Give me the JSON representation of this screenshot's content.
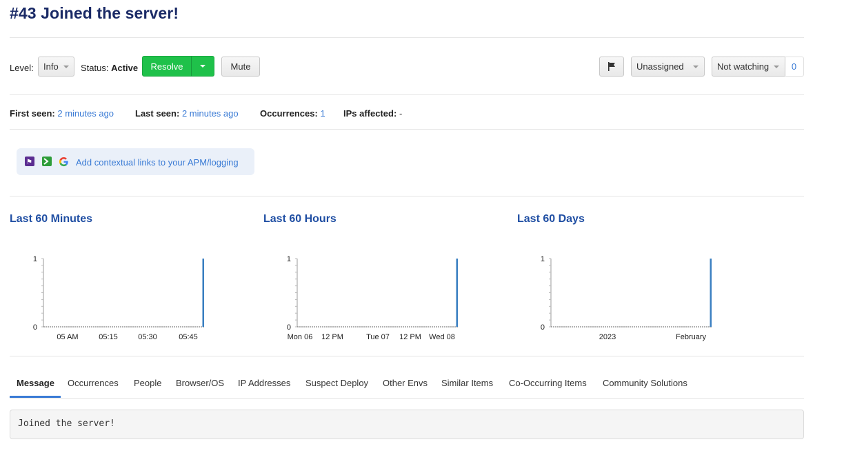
{
  "title": "#43 Joined the server!",
  "controls": {
    "level_label": "Level:",
    "level_value": "Info",
    "status_label": "Status:",
    "status_value": "Active",
    "resolve_label": "Resolve",
    "mute_label": "Mute",
    "assignee_value": "Unassigned",
    "watch_value": "Not watching",
    "watch_count": "0"
  },
  "meta": {
    "first_seen_label": "First seen:",
    "first_seen_value": "2 minutes ago",
    "last_seen_label": "Last seen:",
    "last_seen_value": "2 minutes ago",
    "occurrences_label": "Occurrences:",
    "occurrences_value": "1",
    "ips_label": "IPs affected:",
    "ips_value": "-"
  },
  "contextual_link": "Add contextual links to your APM/logging",
  "charts": {
    "minutes_title": "Last 60 Minutes",
    "hours_title": "Last 60 Hours",
    "days_title": "Last 60 Days"
  },
  "chart_data": [
    {
      "type": "bar",
      "title": "Last 60 Minutes",
      "ylim": [
        0,
        1
      ],
      "yticks": [
        "0",
        "1"
      ],
      "xticks": [
        "05 AM",
        "05:15",
        "05:30",
        "05:45"
      ],
      "values_note_last_bucket": 1,
      "series": [
        {
          "values": [
            0,
            0,
            0,
            0,
            0,
            0,
            0,
            0,
            0,
            0,
            0,
            0,
            0,
            0,
            0,
            0,
            0,
            0,
            0,
            0,
            0,
            0,
            0,
            0,
            0,
            0,
            0,
            0,
            0,
            0,
            0,
            0,
            0,
            0,
            0,
            0,
            0,
            0,
            0,
            0,
            0,
            0,
            0,
            0,
            0,
            0,
            0,
            0,
            0,
            0,
            0,
            0,
            0,
            0,
            0,
            0,
            0,
            0,
            0,
            1
          ]
        }
      ],
      "color": "#3a7fc1"
    },
    {
      "type": "bar",
      "title": "Last 60 Hours",
      "ylim": [
        0,
        1
      ],
      "yticks": [
        "0",
        "1"
      ],
      "xticks": [
        "Mon 06",
        "12 PM",
        "Tue 07",
        "12 PM",
        "Wed 08"
      ],
      "series": [
        {
          "values": [
            0,
            0,
            0,
            0,
            0,
            0,
            0,
            0,
            0,
            0,
            0,
            0,
            0,
            0,
            0,
            0,
            0,
            0,
            0,
            0,
            0,
            0,
            0,
            0,
            0,
            0,
            0,
            0,
            0,
            0,
            0,
            0,
            0,
            0,
            0,
            0,
            0,
            0,
            0,
            0,
            0,
            0,
            0,
            0,
            0,
            0,
            0,
            0,
            0,
            0,
            0,
            0,
            0,
            0,
            0,
            0,
            0,
            0,
            0,
            1
          ]
        }
      ],
      "color": "#3a7fc1"
    },
    {
      "type": "bar",
      "title": "Last 60 Days",
      "ylim": [
        0,
        1
      ],
      "yticks": [
        "0",
        "1"
      ],
      "xticks": [
        "2023",
        "February"
      ],
      "series": [
        {
          "values": [
            0,
            0,
            0,
            0,
            0,
            0,
            0,
            0,
            0,
            0,
            0,
            0,
            0,
            0,
            0,
            0,
            0,
            0,
            0,
            0,
            0,
            0,
            0,
            0,
            0,
            0,
            0,
            0,
            0,
            0,
            0,
            0,
            0,
            0,
            0,
            0,
            0,
            0,
            0,
            0,
            0,
            0,
            0,
            0,
            0,
            0,
            0,
            0,
            0,
            0,
            0,
            0,
            0,
            0,
            0,
            0,
            0,
            0,
            0,
            1
          ]
        }
      ],
      "color": "#3a7fc1"
    }
  ],
  "tabs": [
    "Message",
    "Occurrences",
    "People",
    "Browser/OS",
    "IP Addresses",
    "Suspect Deploy",
    "Other Envs",
    "Similar Items",
    "Co-Occurring Items",
    "Community Solutions"
  ],
  "message_body": "Joined the server!",
  "icons": {
    "flag": "flag-icon",
    "logging_1": "sentry-like-icon",
    "logging_2": "terminal-icon",
    "logging_3": "google-icon"
  },
  "colors": {
    "title": "#1a2a66",
    "link": "#3a7bd5",
    "resolve": "#1fc14a",
    "bar": "#3a7fc1"
  }
}
